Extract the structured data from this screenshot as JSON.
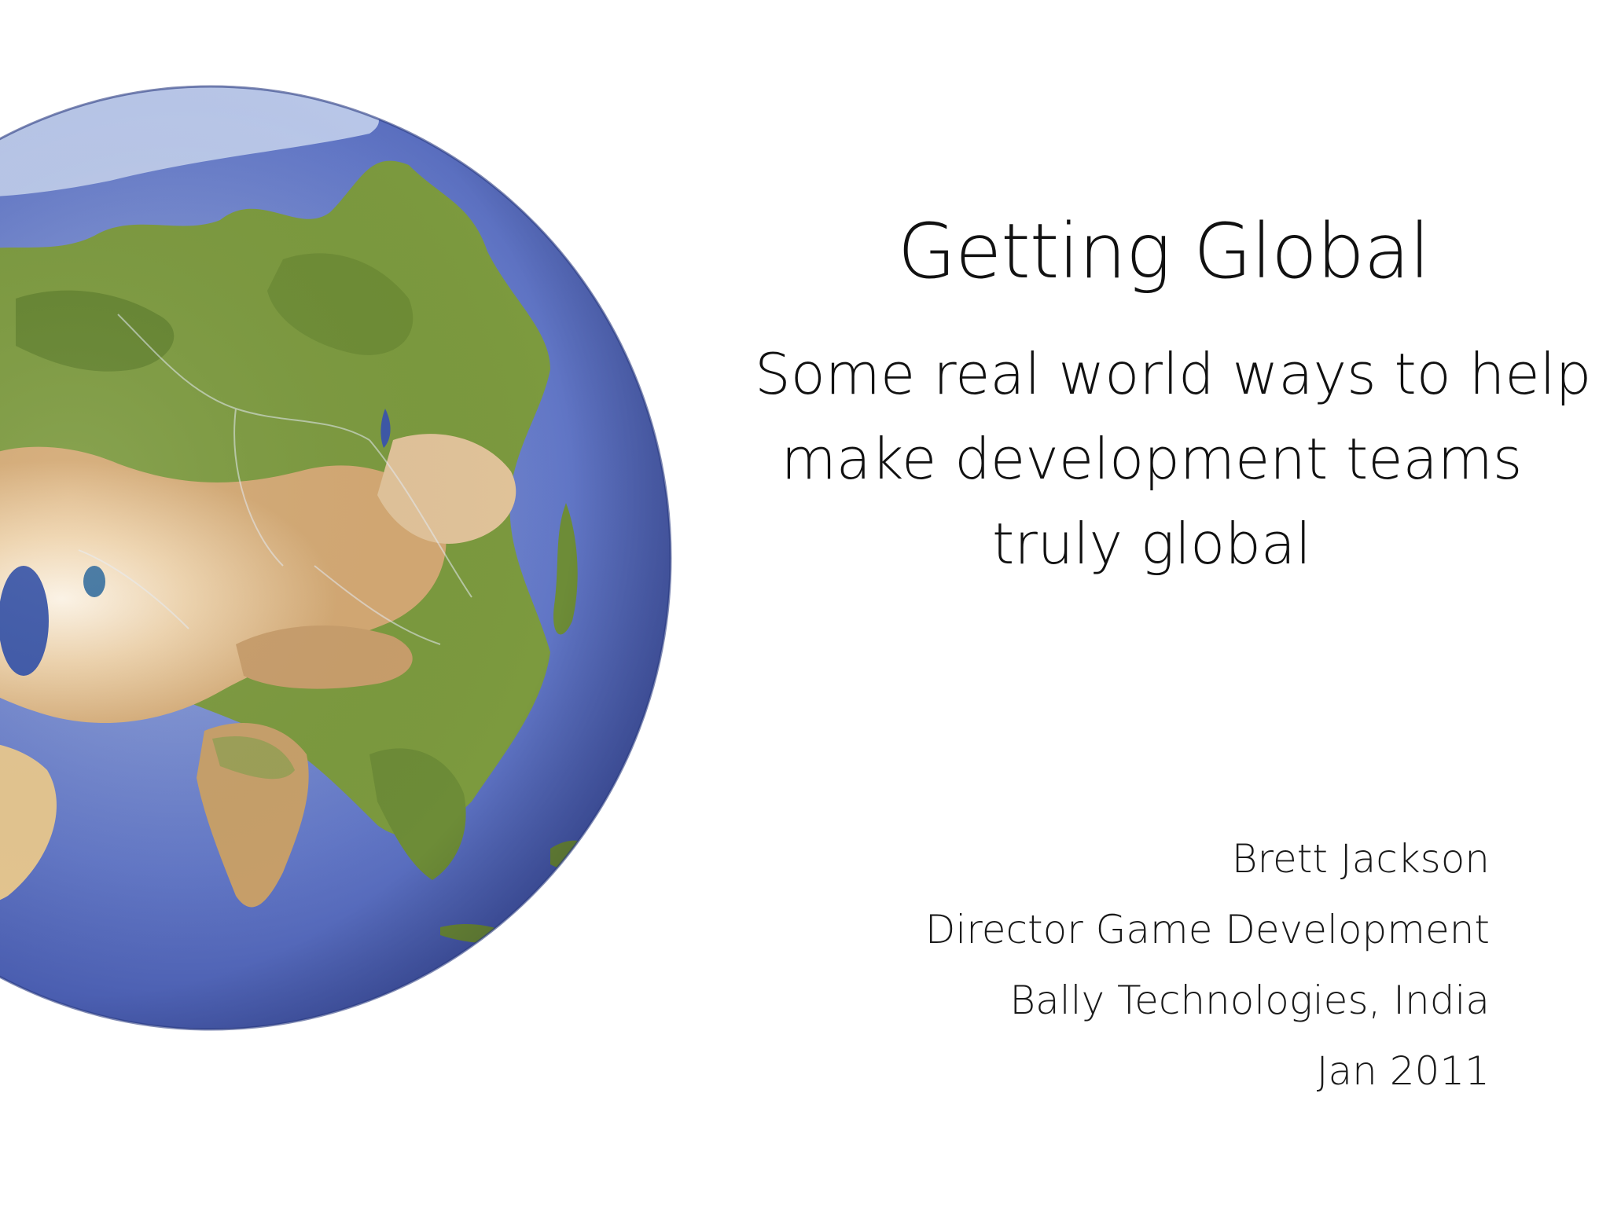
{
  "slide": {
    "title": "Getting Global",
    "subtitle_lines": [
      "Some real world ways to help",
      "make development teams",
      "truly global"
    ],
    "author": "Brett Jackson",
    "role": "Director Game Development",
    "organization": "Bally Technologies, India",
    "date": "Jan 2011"
  },
  "colors": {
    "background": "#ffffff",
    "text": "#111111",
    "ocean": "#4f67b8",
    "land_green": "#6f8f3a",
    "land_desert": "#d8b482"
  }
}
